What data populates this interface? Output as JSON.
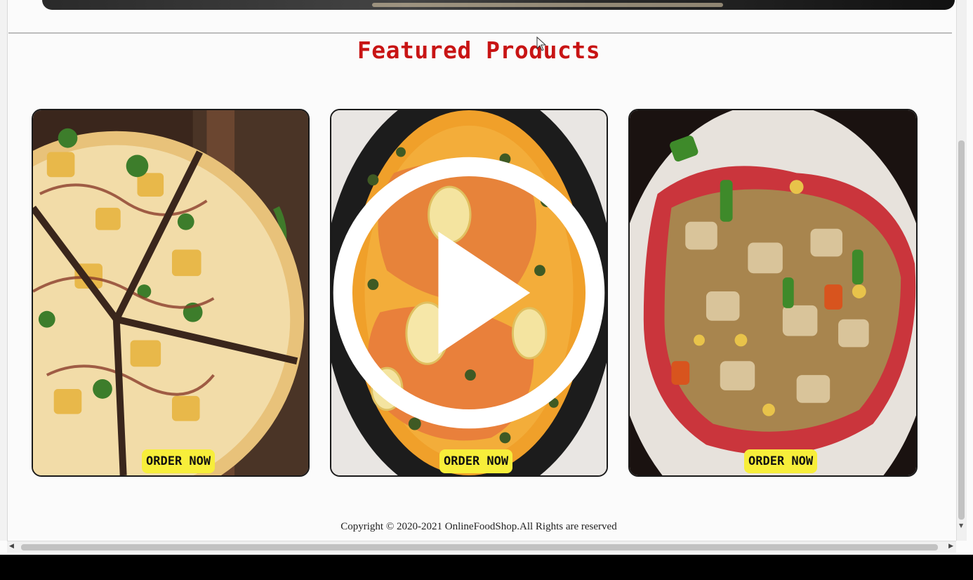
{
  "section": {
    "title": "Featured Products"
  },
  "products": [
    {
      "name": "pizza",
      "button_label": "ORDER NOW"
    },
    {
      "name": "salmon-curry",
      "button_label": "ORDER NOW"
    },
    {
      "name": "paneer-dosa",
      "button_label": "ORDER NOW"
    }
  ],
  "footer": {
    "copyright": "Copyright © 2020-2021 OnlineFoodShop.All Rights are reserved"
  },
  "colors": {
    "title": "#c81414",
    "button_bg": "#f7ee3a"
  },
  "icons": {
    "play": "play-icon",
    "scroll_left": "chevron-left-icon",
    "scroll_right": "chevron-right-icon",
    "scroll_down": "chevron-down-icon",
    "cursor": "mouse-pointer-icon"
  }
}
